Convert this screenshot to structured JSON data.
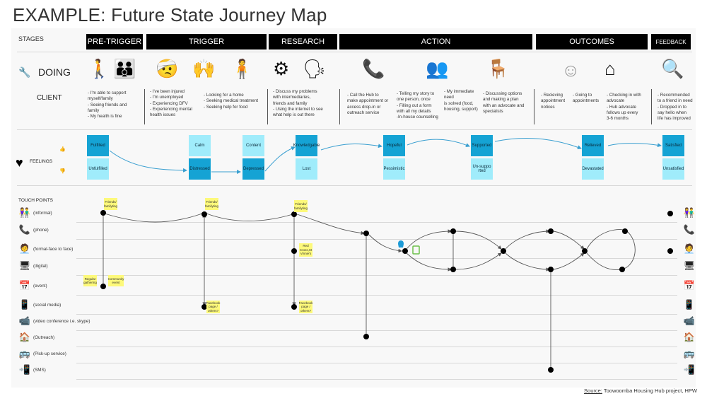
{
  "title": "EXAMPLE: Future State Journey Map",
  "stages": {
    "label": "STAGES",
    "items": [
      {
        "label": "PRE-TRIGGER"
      },
      {
        "label": "TRIGGER"
      },
      {
        "label": "RESEARCH"
      },
      {
        "label": "ACTION"
      },
      {
        "label": "OUTCOMES"
      },
      {
        "label": "FEEDBACK"
      }
    ]
  },
  "doing": {
    "label": "DOING",
    "icon": "wrench-icon",
    "client_label": "CLIENT",
    "icons": [
      "walking-person-icon",
      "family-icon",
      "injured-person-icon",
      "distressed-person-icon",
      "person-icon",
      "gear-search-icon",
      "discussion-heads-icon",
      "phone-call-icon",
      "counselling-icon",
      "meeting-table-icon",
      "smiley-clock-icon",
      "home-heart-icon",
      "thumbs-up-search-icon"
    ],
    "descriptions": [
      "- I'm able to support\nmyself/family\n- Seeing friends and\nfamily\n- My health is fine",
      "- I've been injured\n- I'm unemployed\n- Experiencing DFV\n- Experiencing mental\nhealth issues",
      "- Looking for a home\n- Seeking medical treatment\n- Seeking help for food",
      "- Discuss my problems\nwith intermediaries,\nfriends and family\n- Using the internet to see\nwhat help is out there",
      "- Call the Hub to\nmake appointment or\naccess drop-in or\noutreach service",
      "- Telling my story to\none person, once\n- Filling out a form\nwith all my details\n-In-house counselling",
      "- My immediate\nneed\nis solved (food,\nhousing, support)",
      "- Discussing options\nand making a plan\nwith an advocate and\nspecialists",
      "- Recieving\nappointment\nnotices",
      "- Going to\nappointments",
      "- Checking in with\nadvocate\n- Hub advocate\nfollows up every\n3-6 months",
      "- Recommended\nto a friend in need\n- Dropped in to\nsay hello when\nlife has improved"
    ]
  },
  "feelings": {
    "label": "FEELINGS",
    "pairs": [
      {
        "positive": "Fulfilled",
        "negative": "Unfulfilled",
        "state": "positive"
      },
      {
        "positive": "Calm",
        "negative": "Distressed",
        "state": "negative"
      },
      {
        "positive": "Content",
        "negative": "Depressed",
        "state": "negative"
      },
      {
        "positive": "Knowledgable",
        "negative": "Lost",
        "state": "positive"
      },
      {
        "positive": "Hopeful",
        "negative": "Pessimistic",
        "state": "positive"
      },
      {
        "positive": "Supported",
        "negative": "Un-suppo rted",
        "state": "positive"
      },
      {
        "positive": "Relieved",
        "negative": "Devastated",
        "state": "positive"
      },
      {
        "positive": "Satisfied",
        "negative": "Unsatisfied",
        "state": "positive"
      }
    ],
    "colors": {
      "selected": "#15a3d4",
      "unselected": "#a0ecfb"
    }
  },
  "touchpoints": {
    "title": "TOUCH POINTS",
    "channels": [
      {
        "label": "(informal)",
        "icon": "people-icon"
      },
      {
        "label": "(phone)",
        "icon": "phone-icon"
      },
      {
        "label": "(formal-face to face)",
        "icon": "reception-desk-icon"
      },
      {
        "label": "(digital)",
        "icon": "monitor-icon"
      },
      {
        "label": "(event)",
        "icon": "calendar-icon"
      },
      {
        "label": "(social media)",
        "icon": "mobile-hand-icon"
      },
      {
        "label": "(video conference i.e. skype)",
        "icon": "video-conference-icon"
      },
      {
        "label": "(Outreach)",
        "icon": "house-icon"
      },
      {
        "label": "(Pick-up service)",
        "icon": "bus-icon"
      },
      {
        "label": "(SMS)",
        "icon": "sms-phone-icon"
      }
    ],
    "stickies": [
      "Friends/ familyting",
      "Friends/ familyting",
      "Friends/ familyting",
      "Regular gathering",
      "Community event",
      "Facebook page / others?",
      "Facebook page / others?",
      "Red Cross,St Vinnie's"
    ]
  },
  "source": {
    "prefix": "Source:",
    "text": " Toowoomba Housing Hub project, HPW"
  }
}
